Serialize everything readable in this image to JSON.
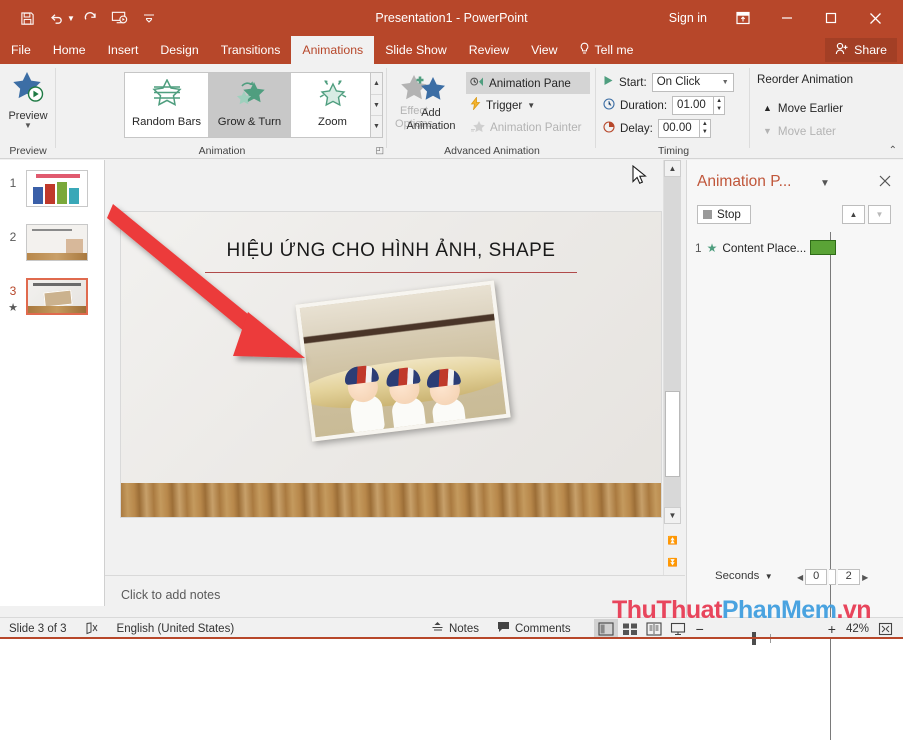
{
  "window": {
    "title": "Presentation1  -  PowerPoint",
    "signin": "Sign in",
    "minimize": "—",
    "maximize": "▢",
    "close": "✕",
    "accent": "#b7472a"
  },
  "quick_access": [
    {
      "name": "save-icon",
      "glyph": "save"
    },
    {
      "name": "undo-icon",
      "glyph": "undo"
    },
    {
      "name": "redo-icon",
      "glyph": "redo"
    },
    {
      "name": "start-slideshow-icon",
      "glyph": "slideshow"
    },
    {
      "name": "customize-qat-icon",
      "glyph": "caret"
    }
  ],
  "tabs": [
    {
      "label": "File",
      "active": false
    },
    {
      "label": "Home",
      "active": false
    },
    {
      "label": "Insert",
      "active": false
    },
    {
      "label": "Design",
      "active": false
    },
    {
      "label": "Transitions",
      "active": false
    },
    {
      "label": "Animations",
      "active": true
    },
    {
      "label": "Slide Show",
      "active": false
    },
    {
      "label": "Review",
      "active": false
    },
    {
      "label": "View",
      "active": false
    }
  ],
  "tellme": "Tell me",
  "share": "Share",
  "ribbon": {
    "groups": {
      "preview": {
        "label": "Preview",
        "button_label": "Preview"
      },
      "animation": {
        "label": "Animation",
        "gallery": [
          {
            "label": "Random Bars",
            "selected": false
          },
          {
            "label": "Grow & Turn",
            "selected": true
          },
          {
            "label": "Zoom",
            "selected": false
          }
        ],
        "effect_options": "Effect Options",
        "effect_options_disabled": true
      },
      "advanced": {
        "label": "Advanced Animation",
        "add_animation": "Add Animation",
        "items": [
          {
            "label": "Animation Pane",
            "highlighted": true,
            "disabled": false
          },
          {
            "label": "Trigger",
            "highlighted": false,
            "disabled": false
          },
          {
            "label": "Animation Painter",
            "highlighted": false,
            "disabled": true
          }
        ]
      },
      "timing": {
        "label": "Timing",
        "start_label": "Start:",
        "start_value": "On Click",
        "duration_label": "Duration:",
        "duration_value": "01.00",
        "delay_label": "Delay:",
        "delay_value": "00.00"
      },
      "reorder": {
        "title": "Reorder Animation",
        "move_earlier": "Move Earlier",
        "move_later": "Move Later",
        "move_later_disabled": true
      }
    }
  },
  "thumbnails": [
    {
      "number": "1",
      "selected": false,
      "has_star": false
    },
    {
      "number": "2",
      "selected": false,
      "has_star": false
    },
    {
      "number": "3",
      "selected": true,
      "has_star": true
    }
  ],
  "slide": {
    "title": "HIỆU ỨNG CHO HÌNH ẢNH, SHAPE",
    "image_alt": "three babies in white outfits with patterned headbands on a bolster pillow",
    "arrow_color": "#ec3a3a"
  },
  "notes": {
    "placeholder": "Click to add notes"
  },
  "animation_pane": {
    "title": "Animation P...",
    "close": "✕",
    "caret": "▼",
    "stop_label": "Stop",
    "move_up": "▲",
    "move_down": "▼",
    "items": [
      {
        "index": "1",
        "label": "Content Place...",
        "bar_color": "#5aa336"
      }
    ],
    "seconds_label": "Seconds",
    "ruler_start": "0",
    "ruler_end": "2"
  },
  "statusbar": {
    "slide_info": "Slide 3 of 3",
    "language": "English (United States)",
    "notes_button": "Notes",
    "comments_button": "Comments",
    "zoom_level": "42%",
    "zoom_minus": "−",
    "zoom_plus": "+"
  },
  "watermark": {
    "part_red_1": "ThuThuat",
    "part_blue": "PhanMem",
    "part_red_2": ".vn"
  }
}
